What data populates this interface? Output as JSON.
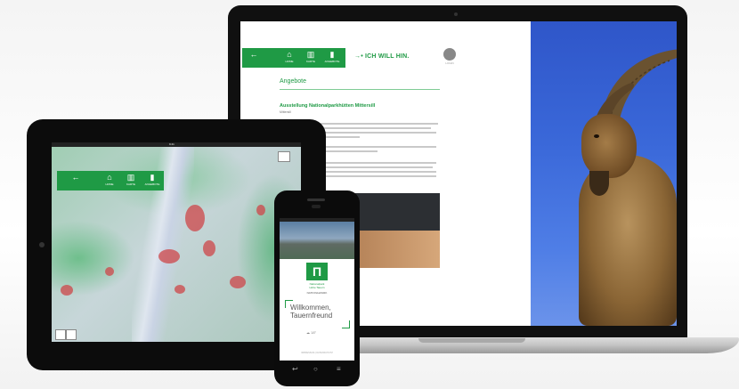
{
  "laptop": {
    "nav_items": [
      {
        "icon": "home-icon",
        "glyph": "⌂",
        "label": "HOME"
      },
      {
        "icon": "map-icon",
        "glyph": "▥",
        "label": "KARTE"
      },
      {
        "icon": "bookmark-icon",
        "glyph": "▮",
        "label": "ANGEBOTE"
      }
    ],
    "back_glyph": "←",
    "i_will_label": "ICH WILL HIN.",
    "i_will_glyph": "→•",
    "user_label": "LOGIN",
    "section_heading": "Angebote",
    "article_title": "Ausstellung Nationalparkhütten Mittersill",
    "article_subtitle": "Mittersill"
  },
  "tablet": {
    "nav_items": [
      {
        "icon": "home-icon",
        "glyph": "⌂",
        "label": "HOME"
      },
      {
        "icon": "map-icon",
        "glyph": "▥",
        "label": "KARTE"
      },
      {
        "icon": "bookmark-icon",
        "glyph": "▮",
        "label": "ANGEBOTE"
      }
    ],
    "back_glyph": "←",
    "status_time": "9:41"
  },
  "phone": {
    "logo_glyph": "Π",
    "brand_line1": "Nationalpark",
    "brand_line2": "Hohe Tauern",
    "brand_sub": "NATIONALPARK",
    "welcome_line1": "Willkommen,",
    "welcome_line2": "Tauernfreund",
    "weather": "☁ 18°",
    "footer": "IMPRESSUM  |  DATENSCHUTZ",
    "keys": [
      "↩",
      "○",
      "≡"
    ]
  },
  "colors": {
    "brand_green": "#1f9a45",
    "sky_blue": "#3a68d9",
    "map_red": "#cd4648"
  }
}
